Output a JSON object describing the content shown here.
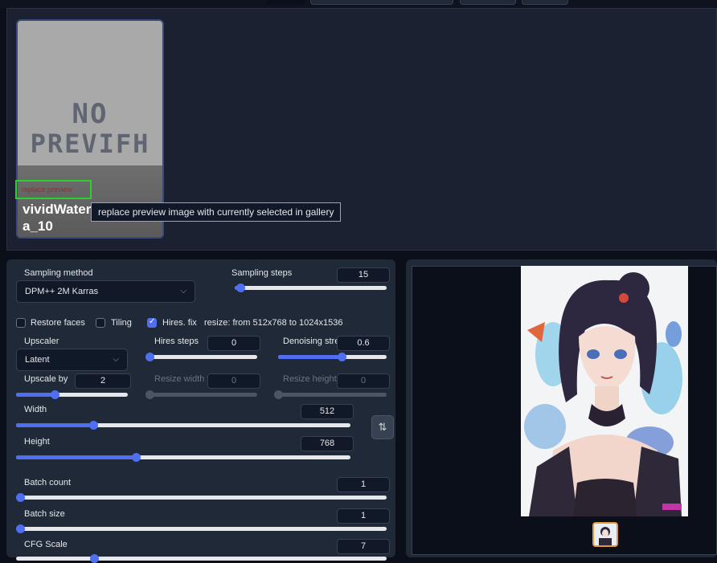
{
  "extra_networks": {
    "card": {
      "preview_placeholder": [
        "NO",
        "PREVIFH"
      ],
      "replace_preview_label": "replace preview",
      "title": "vividWater\na_10"
    },
    "tooltip": "replace preview image with currently selected in gallery"
  },
  "settings": {
    "sampling_method": {
      "label": "Sampling method",
      "value": "DPM++ 2M Karras"
    },
    "sampling_steps": {
      "label": "Sampling steps",
      "value": "15",
      "fraction": 0.1
    },
    "restore_faces": {
      "label": "Restore faces",
      "checked": false
    },
    "tiling": {
      "label": "Tiling",
      "checked": false
    },
    "hires_fix": {
      "label": "Hires. fix",
      "checked": true
    },
    "resize_info": "resize: from 512x768 to 1024x1536",
    "upscaler": {
      "label": "Upscaler",
      "value": "Latent"
    },
    "hires_steps": {
      "label": "Hires steps",
      "value": "0"
    },
    "denoising_strength": {
      "label": "Denoising stre",
      "value": "0.6"
    },
    "upscale_by": {
      "label": "Upscale by",
      "value": "2"
    },
    "resize_width": {
      "label": "Resize width tc",
      "value": "0"
    },
    "resize_height": {
      "label": "Resize height t",
      "value": "0"
    },
    "width": {
      "label": "Width",
      "value": "512"
    },
    "height": {
      "label": "Height",
      "value": "768"
    },
    "batch_count": {
      "label": "Batch count",
      "value": "1"
    },
    "batch_size": {
      "label": "Batch size",
      "value": "1"
    },
    "cfg_scale": {
      "label": "CFG Scale",
      "value": "7"
    },
    "swap_icon": "⇅"
  },
  "icons": {
    "dropdown": "chevron-down-icon",
    "swap": "swap-dimensions-icon"
  },
  "colors": {
    "accent": "#4f6ff0",
    "selected_thumb": "#e49a3a",
    "highlight": "#2dcf2d"
  }
}
